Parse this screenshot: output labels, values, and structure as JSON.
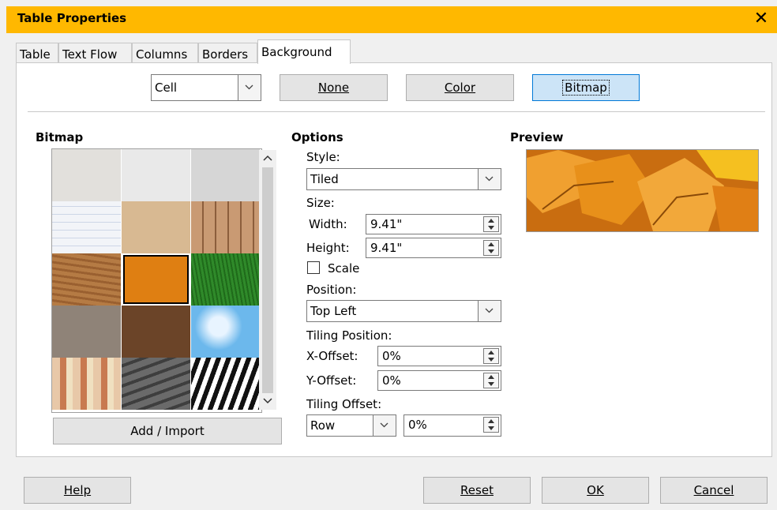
{
  "window": {
    "title": "Table Properties",
    "close_glyph": "✕"
  },
  "tabs": [
    {
      "label": "Table"
    },
    {
      "label": "Text Flow"
    },
    {
      "label": "Columns"
    },
    {
      "label": "Borders"
    },
    {
      "label": "Background",
      "active": true
    }
  ],
  "top": {
    "apply_to": "Cell",
    "none_label": "None",
    "color_label": "Color",
    "bitmap_label": "Bitmap",
    "selected_mode": "Bitmap"
  },
  "bitmap": {
    "heading": "Bitmap",
    "selected_index": 7,
    "tiles": [
      {
        "name": "painted-white",
        "color": "#e2e0dc"
      },
      {
        "name": "paper-texture",
        "color": "#e9e9e9"
      },
      {
        "name": "paper-crumpled",
        "color": "#d6d6d6"
      },
      {
        "name": "paper-graph",
        "color": "#f2f4f8"
      },
      {
        "name": "parchment-paper",
        "color": "#d8b992"
      },
      {
        "name": "fence",
        "color": "#c08e67"
      },
      {
        "name": "wooden-board",
        "color": "#b57b44"
      },
      {
        "name": "maple-leaves",
        "color": "#df7f12"
      },
      {
        "name": "lawn",
        "color": "#2f8a2a"
      },
      {
        "name": "pebble-light",
        "color": "#8f8378"
      },
      {
        "name": "coffee-beans",
        "color": "#6b4428"
      },
      {
        "name": "sky",
        "color": "#6cb8ec"
      },
      {
        "name": "color-stripes",
        "color": "#d9b49a"
      },
      {
        "name": "stone",
        "color": "#585858"
      },
      {
        "name": "zebra",
        "color": "#ffffff"
      }
    ],
    "add_label": "Add / Import"
  },
  "options": {
    "heading": "Options",
    "style_label": "Style:",
    "style_value": "Tiled",
    "size_label": "Size:",
    "width_label": "Width:",
    "width_value": "9.41\"",
    "height_label": "Height:",
    "height_value": "9.41\"",
    "scale_label": "Scale",
    "scale_checked": false,
    "position_label": "Position:",
    "position_value": "Top Left",
    "tiling_position_label": "Tiling Position:",
    "x_offset_label": "X-Offset:",
    "x_offset_value": "0%",
    "y_offset_label": "Y-Offset:",
    "y_offset_value": "0%",
    "tiling_offset_label": "Tiling Offset:",
    "tiling_offset_mode": "Row",
    "tiling_offset_value": "0%"
  },
  "preview": {
    "heading": "Preview"
  },
  "footer": {
    "help_label": "Help",
    "reset_label": "Reset",
    "ok_label": "OK",
    "cancel_label": "Cancel"
  }
}
